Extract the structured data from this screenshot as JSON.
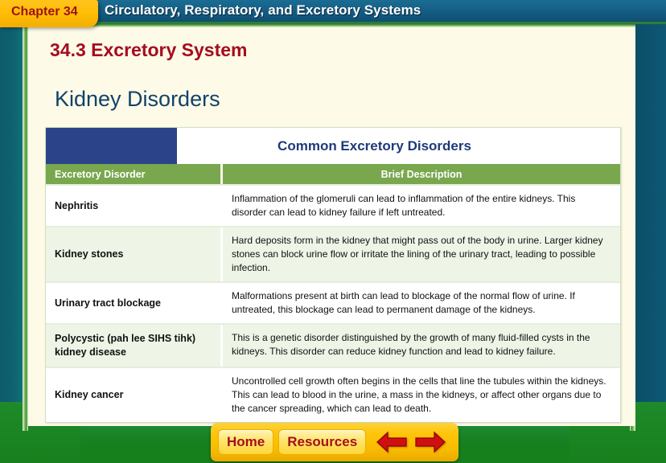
{
  "header": {
    "chapter_label": "Chapter 34",
    "course_title": "Circulatory, Respiratory, and Excretory Systems"
  },
  "slide": {
    "section_title": "34.3 Excretory System",
    "heading": "Kidney Disorders"
  },
  "table": {
    "caption": "Common Excretory Disorders",
    "columns": [
      "Excretory Disorder",
      "Brief Description"
    ],
    "rows": [
      {
        "disorder": "Nephritis",
        "description": "Inflammation of the glomeruli can lead to inflammation of the entire kidneys. This disorder can lead to kidney failure if left untreated."
      },
      {
        "disorder": "Kidney stones",
        "description": "Hard deposits form in the kidney that might pass out of the body in urine. Larger kidney stones can block urine flow or irritate the lining of the urinary tract, leading to possible infection."
      },
      {
        "disorder": "Urinary tract blockage",
        "description": "Malformations present at birth can lead to blockage of the normal flow of urine. If untreated, this blockage can lead to permanent damage of the kidneys."
      },
      {
        "disorder": "Polycystic (pah lee SIHS tihk) kidney disease",
        "description": "This is a genetic disorder distinguished by the growth of many fluid-filled cysts in the kidneys. This disorder can reduce kidney function and lead to kidney failure."
      },
      {
        "disorder": "Kidney cancer",
        "description": "Uncontrolled cell growth often begins in the cells that line the tubules within the kidneys. This can lead to blood in the urine, a mass in the kidneys, or affect other organs due to the cancer spreading, which can lead to death."
      }
    ]
  },
  "nav": {
    "home_label": "Home",
    "resources_label": "Resources",
    "back_icon": "arrow-left-icon",
    "forward_icon": "arrow-right-icon"
  },
  "colors": {
    "chapter_tab": "#ffbe06",
    "chapter_text": "#9e1116",
    "topbar": "#12567c",
    "section_title": "#a40d1e",
    "heading": "#10426b",
    "table_caption_swatch": "#2b4489",
    "table_header_green": "#79a74e",
    "row_alt": "#eef5e6",
    "frame_green": "#17801f",
    "frame_teal": "#0f6070",
    "nav_gold": "#ffc409",
    "nav_text": "#a4101a"
  }
}
